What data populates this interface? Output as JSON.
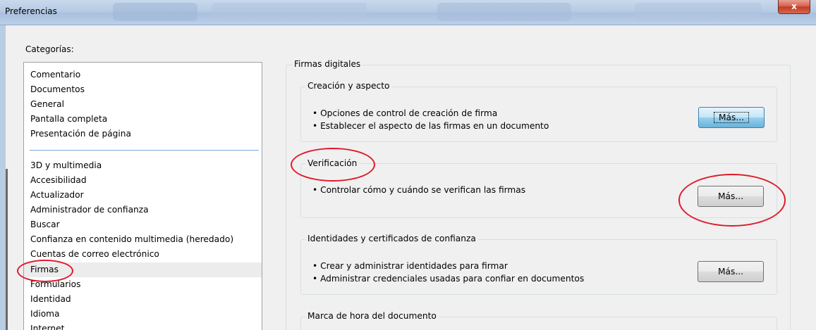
{
  "window": {
    "title": "Preferencias",
    "close_label": "x"
  },
  "sidebar": {
    "label": "Categorías:",
    "items": [
      "Comentario",
      "Documentos",
      "General",
      "Pantalla completa",
      "Presentación de página",
      "3D y multimedia",
      "Accesibilidad",
      "Actualizador",
      "Administrador de confianza",
      "Buscar",
      "Confianza en contenido multimedia (heredado)",
      "Cuentas de correo electrónico",
      "Firmas",
      "Formularios",
      "Identidad",
      "Idioma",
      "Internet"
    ],
    "selected": "Firmas"
  },
  "main": {
    "title": "Firmas digitales",
    "sections": [
      {
        "title": "Creación y aspecto",
        "bullets": [
          "• Opciones de control de creación de firma",
          "• Establecer el aspecto de las firmas en un documento"
        ],
        "button": "Más..."
      },
      {
        "title": "Verificación",
        "bullets": [
          "• Controlar cómo y cuándo se verifican las firmas"
        ],
        "button": "Más..."
      },
      {
        "title": "Identidades y certificados de confianza",
        "bullets": [
          "• Crear y administrar identidades para firmar",
          "• Administrar credenciales usadas para confiar en documentos"
        ],
        "button": "Más..."
      },
      {
        "title": "Marca de hora del documento",
        "bullets": []
      }
    ]
  },
  "annotations": {
    "color": "#e0192a"
  }
}
